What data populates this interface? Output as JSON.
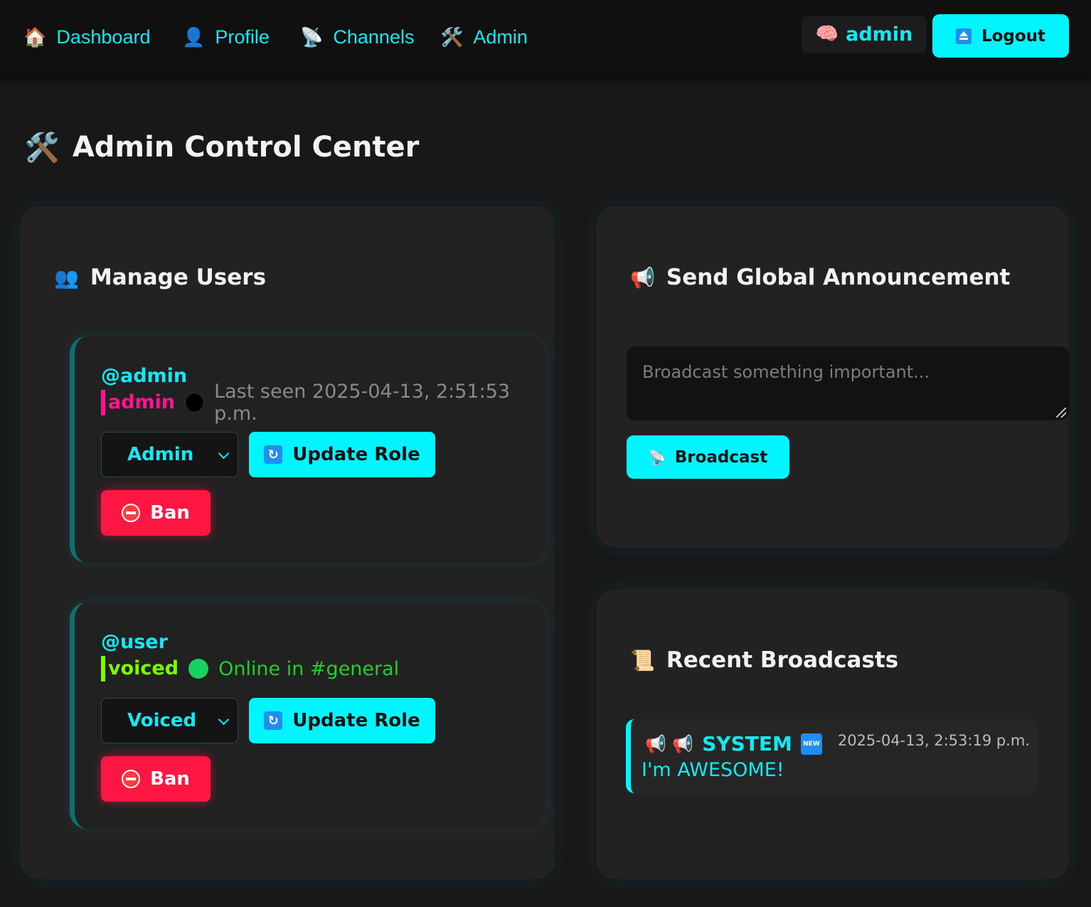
{
  "nav": {
    "links": [
      {
        "icon": "house-icon",
        "emoji": "🏠",
        "label": "Dashboard"
      },
      {
        "icon": "person-icon",
        "emoji": "👤",
        "label": "Profile"
      },
      {
        "icon": "satellite-icon",
        "emoji": "📡",
        "label": "Channels"
      },
      {
        "icon": "tools-icon",
        "emoji": "🛠️",
        "label": "Admin"
      }
    ],
    "user": {
      "emoji": "🧠",
      "name": "admin"
    },
    "logout_label": "Logout"
  },
  "page": {
    "emoji": "🛠️",
    "title": "Admin Control Center"
  },
  "manage_users": {
    "emoji": "👥",
    "title": "Manage Users",
    "users": [
      {
        "handle": "@admin",
        "role_tag": "admin",
        "role_color": "#ff1493",
        "status_color": "#000000",
        "status_text": "Last seen 2025-04-13, 2:51:53 p.m.",
        "status_text_color": "#8a8a8a",
        "role_value": "Admin",
        "update_label": "Update Role",
        "ban_label": "Ban"
      },
      {
        "handle": "@user",
        "role_tag": "voiced",
        "role_color": "#7cfc00",
        "status_color": "#19d15e",
        "status_text": "Online in #general",
        "status_text_color": "#1fd12a",
        "role_value": "Voiced",
        "update_label": "Update Role",
        "ban_label": "Ban"
      }
    ]
  },
  "announcement": {
    "emoji": "📢",
    "title": "Send Global Announcement",
    "placeholder": "Broadcast something important...",
    "button_emoji": "📡",
    "button_label": "Broadcast"
  },
  "recent": {
    "emoji": "📜",
    "title": "Recent Broadcasts",
    "items": [
      {
        "sender_emoji": "📢 📢",
        "sender": "SYSTEM",
        "badge": "NEW",
        "timestamp": "2025-04-13, 2:53:19 p.m.",
        "message": "I'm AWESOME!"
      }
    ]
  },
  "colors": {
    "accent": "#00f5ff",
    "danger": "#ff1744",
    "background": "#181818",
    "panel": "#222222"
  }
}
